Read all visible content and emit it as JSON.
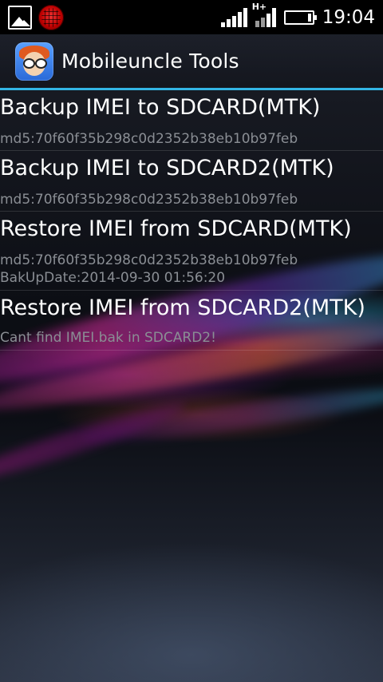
{
  "status_bar": {
    "left_icons": [
      "gallery-icon",
      "spider-icon"
    ],
    "network_label": "H+",
    "time": "19:04"
  },
  "action_bar": {
    "title": "Mobileuncle Tools",
    "accent_color": "#33b5e5"
  },
  "list": {
    "items": [
      {
        "title": "Backup IMEI to SDCARD(MTK)",
        "lines": [
          "md5:70f60f35b298c0d2352b38eb10b97feb"
        ]
      },
      {
        "title": "Backup IMEI to SDCARD2(MTK)",
        "lines": [
          "md5:70f60f35b298c0d2352b38eb10b97feb"
        ]
      },
      {
        "title": "Restore IMEI from SDCARD(MTK)",
        "lines": [
          "md5:70f60f35b298c0d2352b38eb10b97feb",
          "BakUpDate:2014-09-30 01:56:20"
        ]
      },
      {
        "title": "Restore IMEI from SDCARD2(MTK)",
        "lines": [
          "Cant find IMEI.bak in SDCARD2!"
        ]
      }
    ]
  }
}
